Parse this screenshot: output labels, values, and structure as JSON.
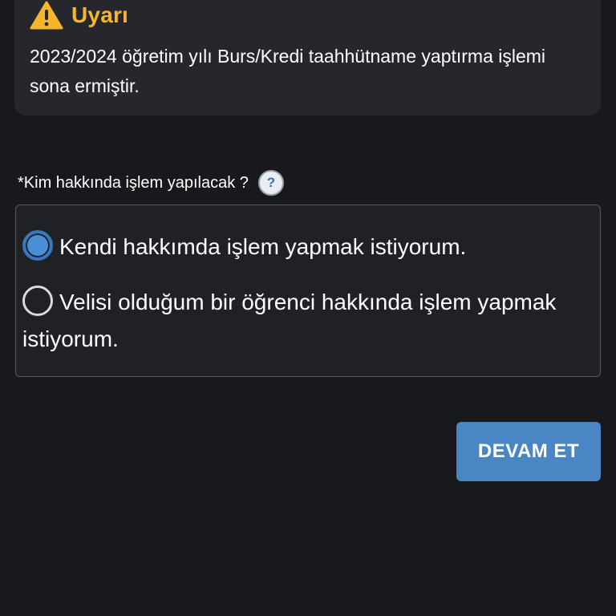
{
  "alert": {
    "icon": "warning-triangle-icon",
    "title": "Uyarı",
    "message": "2023/2024 öğretim yılı Burs/Kredi taahhütname yaptırma işlemi sona ermiştir.",
    "title_color": "#f5b62e"
  },
  "question": {
    "label": "*Kim hakkında işlem yapılacak ?",
    "help_label": "?",
    "help_icon": "question-mark-icon"
  },
  "options": [
    {
      "label": "Kendi hakkımda işlem yapmak istiyorum.",
      "selected": true
    },
    {
      "label": "Velisi olduğum bir öğrenci hakkında işlem yapmak istiyorum.",
      "selected": false
    }
  ],
  "actions": {
    "continue_label": "DEVAM ET",
    "accent_color": "#4a85c4"
  }
}
